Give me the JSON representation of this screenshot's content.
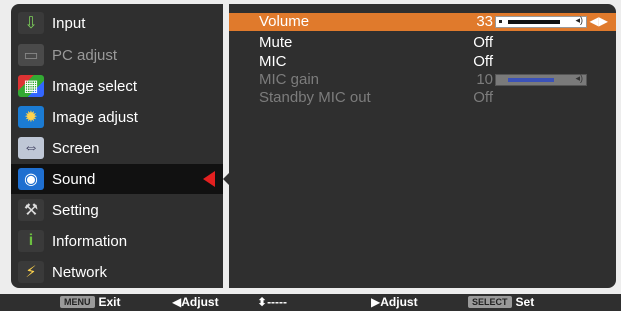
{
  "menu": {
    "items": [
      {
        "label": "Input",
        "icon": "input-arrow-icon",
        "dim": false,
        "selected": false
      },
      {
        "label": "PC adjust",
        "icon": "monitor-icon",
        "dim": true,
        "selected": false
      },
      {
        "label": "Image select",
        "icon": "image-select-icon",
        "dim": false,
        "selected": false
      },
      {
        "label": "Image adjust",
        "icon": "image-adjust-icon",
        "dim": false,
        "selected": false
      },
      {
        "label": "Screen",
        "icon": "screen-icon",
        "dim": false,
        "selected": false
      },
      {
        "label": "Sound",
        "icon": "speaker-icon",
        "dim": false,
        "selected": true
      },
      {
        "label": "Setting",
        "icon": "tools-icon",
        "dim": false,
        "selected": false
      },
      {
        "label": "Information",
        "icon": "info-icon",
        "dim": false,
        "selected": false
      },
      {
        "label": "Network",
        "icon": "network-icon",
        "dim": false,
        "selected": false
      }
    ]
  },
  "sound": {
    "rows": [
      {
        "label": "Volume",
        "value": "33",
        "dim": false,
        "active": true,
        "level": 0.82
      },
      {
        "label": "Mute",
        "value": "Off",
        "dim": false,
        "active": false
      },
      {
        "label": "MIC",
        "value": "Off",
        "dim": false,
        "active": false
      },
      {
        "label": "MIC gain",
        "value": "10",
        "dim": true,
        "active": false,
        "level": 0.72
      },
      {
        "label": "Standby MIC out",
        "value": "Off",
        "dim": true,
        "active": false
      }
    ]
  },
  "footer": {
    "exit_key": "MENU",
    "exit_label": "Exit",
    "adjust_left": "Adjust",
    "updown": "-----",
    "adjust_right": "Adjust",
    "select_key": "SELECT",
    "set_label": "Set"
  },
  "colors": {
    "highlight": "#e07a2c",
    "panel": "#2f2f2f",
    "indicator": "#e32020"
  }
}
